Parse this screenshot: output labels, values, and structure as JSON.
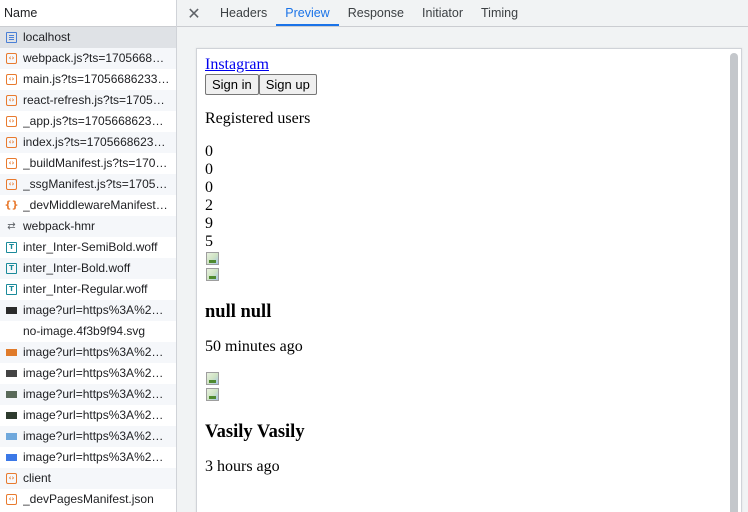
{
  "list": {
    "header": "Name",
    "rows": [
      {
        "name": "localhost",
        "icon": "document-icon"
      },
      {
        "name": "webpack.js?ts=1705668…",
        "icon": "script-icon"
      },
      {
        "name": "main.js?ts=1705668623321",
        "icon": "script-icon"
      },
      {
        "name": "react-refresh.js?ts=1705…",
        "icon": "script-icon"
      },
      {
        "name": "_app.js?ts=17056686233…",
        "icon": "script-icon"
      },
      {
        "name": "index.js?ts=1705668623…",
        "icon": "script-icon"
      },
      {
        "name": "_buildManifest.js?ts=170…",
        "icon": "script-icon"
      },
      {
        "name": "_ssgManifest.js?ts=1705…",
        "icon": "script-icon"
      },
      {
        "name": "_devMiddlewareManifest…",
        "icon": "manifest-icon"
      },
      {
        "name": "webpack-hmr",
        "icon": "websocket-icon"
      },
      {
        "name": "inter_Inter-SemiBold.woff",
        "icon": "font-icon"
      },
      {
        "name": "inter_Inter-Bold.woff",
        "icon": "font-icon"
      },
      {
        "name": "inter_Inter-Regular.woff",
        "icon": "font-icon"
      },
      {
        "name": "image?url=https%3A%2…",
        "icon": "image-thumb-icon",
        "thumb": "#2b2b2b"
      },
      {
        "name": "no-image.4f3b9f94.svg",
        "icon": "image-thumb-icon",
        "thumb": "#ffffff"
      },
      {
        "name": "image?url=https%3A%2…",
        "icon": "image-thumb-icon",
        "thumb": "#e07b2a"
      },
      {
        "name": "image?url=https%3A%2…",
        "icon": "image-thumb-icon",
        "thumb": "#444444"
      },
      {
        "name": "image?url=https%3A%2…",
        "icon": "image-thumb-icon",
        "thumb": "#5a6a5a"
      },
      {
        "name": "image?url=https%3A%2…",
        "icon": "image-thumb-icon",
        "thumb": "#2e3b2e"
      },
      {
        "name": "image?url=https%3A%2…",
        "icon": "image-thumb-icon",
        "thumb": "#6fa8dc"
      },
      {
        "name": "image?url=https%3A%2…",
        "icon": "image-thumb-icon",
        "thumb": "#3b78e7"
      },
      {
        "name": "client",
        "icon": "script-icon"
      },
      {
        "name": "_devPagesManifest.json",
        "icon": "script-icon"
      }
    ]
  },
  "tabs": {
    "close": "✕",
    "items": [
      "Headers",
      "Preview",
      "Response",
      "Initiator",
      "Timing"
    ],
    "active": "Preview"
  },
  "preview": {
    "link": "Instagram",
    "sign_in": "Sign in",
    "sign_up": "Sign up",
    "registered": "Registered users",
    "numbers": [
      "0",
      "0",
      "0",
      "2",
      "9",
      "5"
    ],
    "post1_name": "null null",
    "post1_time": "50 minutes ago",
    "post2_name": "Vasily Vasily",
    "post2_time": "3 hours ago"
  }
}
